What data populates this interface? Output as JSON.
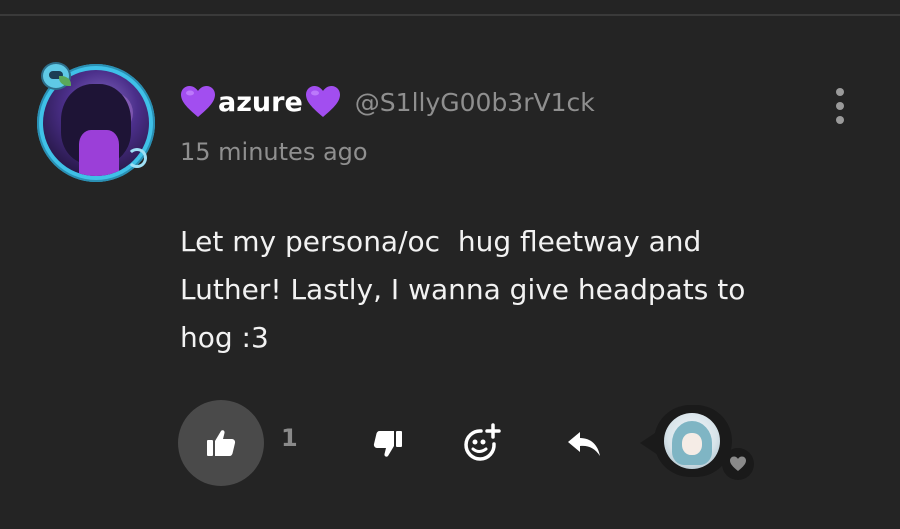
{
  "comment": {
    "display_name": "azure",
    "handle": "@S1llyG00b3rV1ck",
    "timestamp": "15 minutes ago",
    "body": "Let my persona/oc  hug fleetway and\nLuther! Lastly, I wanna give headpats to\nhog :3",
    "like_count": "1",
    "name_decoration": "purple-heart-emoji"
  },
  "icons": {
    "more": "vertical-dots-icon",
    "like": "thumbs-up-icon",
    "dislike": "thumbs-down-icon",
    "react": "add-reaction-icon",
    "reply": "reply-arrow-icon",
    "replier_heart": "heart-icon"
  },
  "colors": {
    "background": "#242424",
    "text_primary": "#f2f2f2",
    "text_secondary": "#8f8f8f",
    "heart_purple": "#a24ef0",
    "avatar_ring": "#3fc1e8",
    "like_button_bg": "#4a4a4a"
  }
}
